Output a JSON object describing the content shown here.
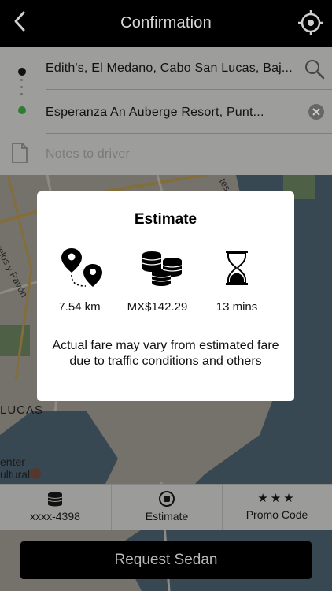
{
  "header": {
    "title": "Confirmation",
    "back_icon": "chevron-left-icon",
    "locate_icon": "crosshair-icon"
  },
  "route": {
    "origin": "Edith's, El Medano, Cabo San Lucas, Baj...",
    "destination": "Esperanza An Auberge Resort, Punt...",
    "notes_placeholder": "Notes to driver"
  },
  "map_labels": {
    "street": "Morelos y Pavón",
    "district": "LUCAS",
    "poi_line1": "enter",
    "poi_line2": "ultural",
    "corner": "tes"
  },
  "estimate": {
    "title": "Estimate",
    "distance": "7.54 km",
    "fare": "MX$142.29",
    "duration": "13 mins",
    "disclaimer": "Actual fare may vary from estimated fare due to traffic conditions and others"
  },
  "options": {
    "payment": "xxxx-4398",
    "estimate": "Estimate",
    "promo": "Promo Code"
  },
  "request_button": "Request Sedan",
  "colors": {
    "header_bg": "#000000",
    "destination_dot": "#2e7d32",
    "button_bg": "#000000"
  }
}
